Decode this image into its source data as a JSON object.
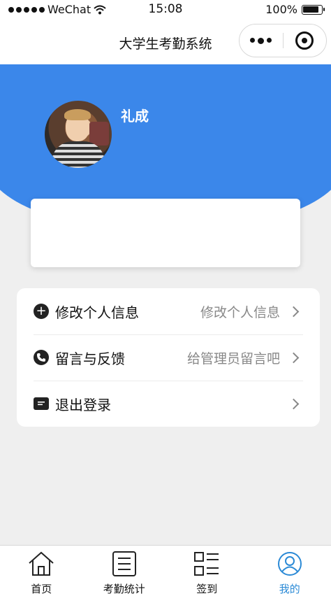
{
  "status_bar": {
    "carrier": "WeChat",
    "time": "15:08",
    "battery": "100%"
  },
  "nav": {
    "title": "大学生考勤系统"
  },
  "profile": {
    "name": "礼成"
  },
  "menu": [
    {
      "label": "修改个人信息",
      "value": "修改个人信息",
      "icon": "plus-circle-icon"
    },
    {
      "label": "留言与反馈",
      "value": "给管理员留言吧",
      "icon": "phone-icon"
    },
    {
      "label": "退出登录",
      "value": "",
      "icon": "message-icon"
    }
  ],
  "tabs": [
    {
      "label": "首页",
      "icon": "home-icon",
      "active": false
    },
    {
      "label": "考勤统计",
      "icon": "list-icon",
      "active": false
    },
    {
      "label": "签到",
      "icon": "grid-list-icon",
      "active": false
    },
    {
      "label": "我的",
      "icon": "user-icon",
      "active": true
    }
  ],
  "colors": {
    "header_blue": "#3b87ea",
    "tab_active": "#2b8ad6",
    "background": "#efefef"
  }
}
